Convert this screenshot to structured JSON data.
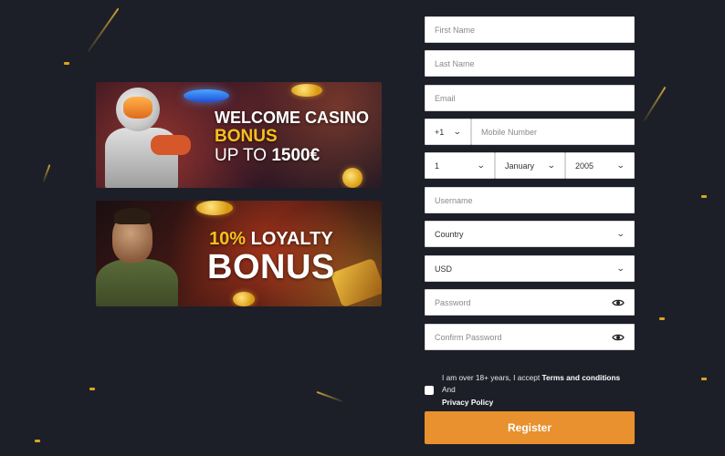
{
  "banners": {
    "welcome": {
      "line1": "WELCOME CASINO",
      "line2": "BONUS",
      "line3_prefix": "UP TO",
      "line3_amount": "1500€"
    },
    "loyalty": {
      "line1_accent": "10%",
      "line1_rest": "LOYALTY",
      "line2": "BONUS"
    }
  },
  "form": {
    "first_name": {
      "placeholder": "First Name"
    },
    "last_name": {
      "placeholder": "Last Name"
    },
    "email": {
      "placeholder": "Email"
    },
    "phone_code": {
      "value": "+1"
    },
    "mobile": {
      "placeholder": "Mobile Number"
    },
    "dob": {
      "day": "1",
      "month": "January",
      "year": "2005"
    },
    "username": {
      "placeholder": "Username"
    },
    "country": {
      "value": "Country"
    },
    "currency": {
      "value": "USD"
    },
    "password": {
      "placeholder": "Password"
    },
    "confirm_password": {
      "placeholder": "Confirm Password"
    },
    "terms": {
      "prefix": "I am over 18+ years, I accept",
      "terms_link": "Terms and conditions",
      "and": "And",
      "privacy_link": "Privacy Policy"
    },
    "register_label": "Register"
  },
  "colors": {
    "background": "#1d1f28",
    "accent": "#e8912e",
    "gold": "#f7c01d"
  },
  "icons": {
    "password_toggle": "eye-icon",
    "select_arrow": "chevron-down-icon"
  }
}
